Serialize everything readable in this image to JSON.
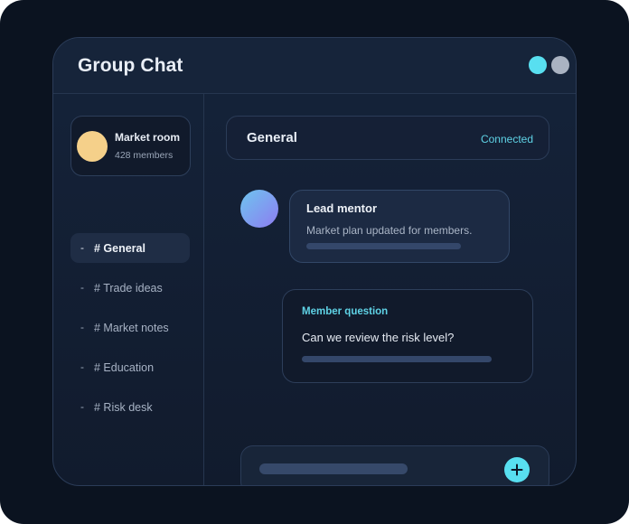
{
  "window": {
    "title": "Group Chat",
    "window_dots": [
      {
        "icon": "window-dot-icon",
        "color": "#58dff0"
      },
      {
        "icon": "window-dot-icon",
        "color": "#aab3c2"
      }
    ]
  },
  "sidebar": {
    "room": {
      "name": "Market room",
      "members": "428 members",
      "avatar_color": "#f5d08a"
    },
    "channels": [
      {
        "dash": "-",
        "label": "# General",
        "active": true
      },
      {
        "dash": "-",
        "label": "# Trade ideas",
        "active": false
      },
      {
        "dash": "-",
        "label": "# Market notes",
        "active": false
      },
      {
        "dash": "-",
        "label": "# Education",
        "active": false
      },
      {
        "dash": "-",
        "label": "# Risk desk",
        "active": false
      }
    ]
  },
  "main": {
    "header": {
      "title": "General",
      "status": "Connected"
    },
    "messages": [
      {
        "sender": "Lead mentor",
        "text": "Market plan updated for members."
      },
      {
        "tag": "Member question",
        "text": "Can we review the risk level?"
      }
    ],
    "composer": {
      "send_icon": "plus-icon"
    }
  },
  "colors": {
    "accent": "#58dff0",
    "background": "#0b1320",
    "panel": "#15233a"
  }
}
